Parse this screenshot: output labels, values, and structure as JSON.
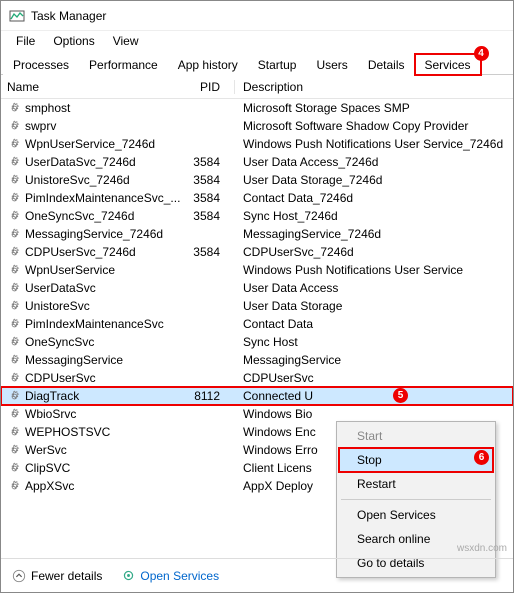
{
  "window": {
    "title": "Task Manager"
  },
  "menu": {
    "file": "File",
    "options": "Options",
    "view": "View"
  },
  "tabs": [
    {
      "label": "Processes"
    },
    {
      "label": "Performance"
    },
    {
      "label": "App history"
    },
    {
      "label": "Startup"
    },
    {
      "label": "Users"
    },
    {
      "label": "Details"
    },
    {
      "label": "Services",
      "active": true,
      "highlight": true,
      "badge": "4"
    }
  ],
  "columns": {
    "name": "Name",
    "pid": "PID",
    "desc": "Description"
  },
  "services": [
    {
      "name": "smphost",
      "pid": "",
      "desc": "Microsoft Storage Spaces SMP"
    },
    {
      "name": "swprv",
      "pid": "",
      "desc": "Microsoft Software Shadow Copy Provider"
    },
    {
      "name": "WpnUserService_7246d",
      "pid": "",
      "desc": "Windows Push Notifications User Service_7246d"
    },
    {
      "name": "UserDataSvc_7246d",
      "pid": "3584",
      "desc": "User Data Access_7246d"
    },
    {
      "name": "UnistoreSvc_7246d",
      "pid": "3584",
      "desc": "User Data Storage_7246d"
    },
    {
      "name": "PimIndexMaintenanceSvc_...",
      "pid": "3584",
      "desc": "Contact Data_7246d"
    },
    {
      "name": "OneSyncSvc_7246d",
      "pid": "3584",
      "desc": "Sync Host_7246d"
    },
    {
      "name": "MessagingService_7246d",
      "pid": "",
      "desc": "MessagingService_7246d"
    },
    {
      "name": "CDPUserSvc_7246d",
      "pid": "3584",
      "desc": "CDPUserSvc_7246d"
    },
    {
      "name": "WpnUserService",
      "pid": "",
      "desc": "Windows Push Notifications User Service"
    },
    {
      "name": "UserDataSvc",
      "pid": "",
      "desc": "User Data Access"
    },
    {
      "name": "UnistoreSvc",
      "pid": "",
      "desc": "User Data Storage"
    },
    {
      "name": "PimIndexMaintenanceSvc",
      "pid": "",
      "desc": "Contact Data"
    },
    {
      "name": "OneSyncSvc",
      "pid": "",
      "desc": "Sync Host"
    },
    {
      "name": "MessagingService",
      "pid": "",
      "desc": "MessagingService"
    },
    {
      "name": "CDPUserSvc",
      "pid": "",
      "desc": "CDPUserSvc"
    },
    {
      "name": "DiagTrack",
      "pid": "8112",
      "desc": "Connected U",
      "selected": true,
      "highlight": true,
      "badge": "5"
    },
    {
      "name": "WbioSrvc",
      "pid": "",
      "desc": "Windows Bio"
    },
    {
      "name": "WEPHOSTSVC",
      "pid": "",
      "desc": "Windows Enc"
    },
    {
      "name": "WerSvc",
      "pid": "",
      "desc": "Windows Erro"
    },
    {
      "name": "ClipSVC",
      "pid": "",
      "desc": "Client Licens"
    },
    {
      "name": "AppXSvc",
      "pid": "",
      "desc": "AppX Deploy"
    }
  ],
  "context_menu": {
    "start": "Start",
    "stop": "Stop",
    "stop_badge": "6",
    "restart": "Restart",
    "open_services": "Open Services",
    "search_online": "Search online",
    "go_to_details": "Go to details"
  },
  "status": {
    "fewer": "Fewer details",
    "open_services": "Open Services"
  },
  "watermark": "wsxdn.com"
}
